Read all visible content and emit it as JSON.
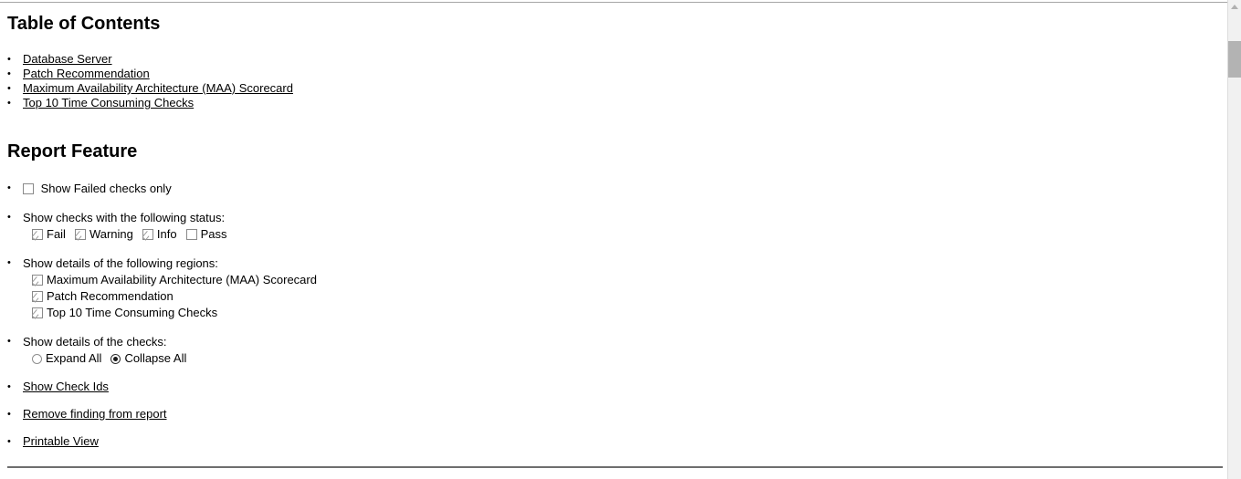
{
  "toc": {
    "heading": "Table of Contents",
    "items": [
      {
        "label": "Database Server"
      },
      {
        "label": "Patch Recommendation"
      },
      {
        "label": "Maximum Availability Architecture (MAA) Scorecard"
      },
      {
        "label": "Top 10 Time Consuming Checks"
      }
    ]
  },
  "report_feature": {
    "heading": "Report Feature",
    "show_failed_only": {
      "label": "Show Failed checks only",
      "checked": false
    },
    "status_filter": {
      "label": "Show checks with the following status:",
      "options": [
        {
          "label": "Fail",
          "checked": true
        },
        {
          "label": "Warning",
          "checked": true
        },
        {
          "label": "Info",
          "checked": true
        },
        {
          "label": "Pass",
          "checked": false
        }
      ]
    },
    "regions_filter": {
      "label": "Show details of the following regions:",
      "options": [
        {
          "label": "Maximum Availability Architecture (MAA) Scorecard",
          "checked": true
        },
        {
          "label": "Patch Recommendation",
          "checked": true
        },
        {
          "label": "Top 10 Time Consuming Checks",
          "checked": true
        }
      ]
    },
    "checks_detail": {
      "label": "Show details of the checks:",
      "options": [
        {
          "label": "Expand All",
          "selected": false
        },
        {
          "label": "Collapse All",
          "selected": true
        }
      ]
    },
    "links": [
      {
        "label": "Show Check Ids"
      },
      {
        "label": "Remove finding from report"
      },
      {
        "label": "Printable View"
      }
    ]
  },
  "scrollbar": {
    "up_arrow_icon": "chevron-up-icon"
  }
}
